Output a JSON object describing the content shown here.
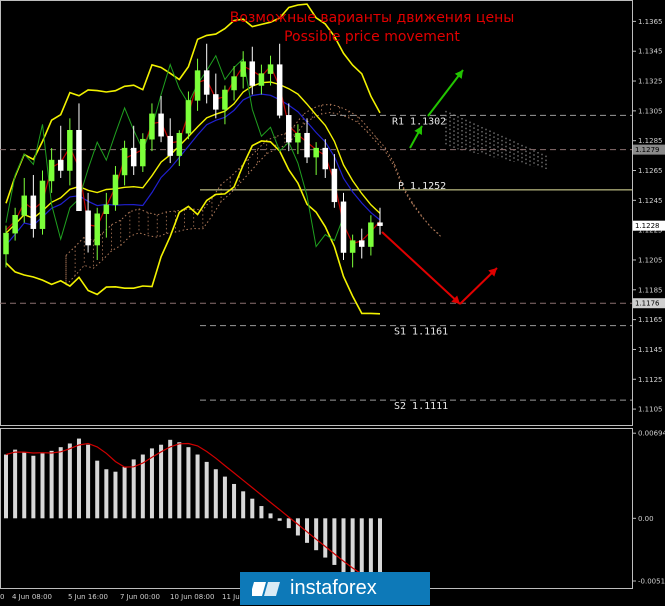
{
  "chart_data": {
    "type": "candlestick",
    "title_ru": "Возможные варианты движения цены",
    "title_en": "Possible price movement",
    "x_tick_labels": [
      "0",
      "4 Jun 08:00",
      "5 Jun 16:00",
      "7 Jun 00:00",
      "10 Jun 08:00",
      "11 Jun"
    ],
    "y_tick_labels": [
      "1.1365",
      "1.1345",
      "1.1325",
      "1.1305",
      "1.1285",
      "1.1265",
      "1.1245",
      "1.1225",
      "1.1205",
      "1.1185",
      "1.1165",
      "1.1145",
      "1.1125",
      "1.1105"
    ],
    "ylim": [
      1.1095,
      1.1378
    ],
    "levels": [
      {
        "label": "R1",
        "value": 1.1302
      },
      {
        "label": "P",
        "value": 1.1252
      },
      {
        "label": "S1",
        "value": 1.1161
      },
      {
        "label": "S2",
        "value": 1.1111
      }
    ],
    "level_labels": [
      "R1  1.1302",
      "P  1.1252",
      "S1  1.1161",
      "S2  1.1111"
    ],
    "price_tags": [
      "1.1279",
      "1.1228",
      "1.1176"
    ],
    "price_tag_values": [
      1.1279,
      1.1228,
      1.1176
    ],
    "price_tag_colors": [
      "#8a8a8a",
      "#ffffff",
      "#d0d0d0"
    ],
    "oscillator": {
      "y_tick_labels": [
        "0.00694",
        "0.00",
        "-0.00511"
      ],
      "ylim": [
        -0.0056,
        0.0072
      ]
    },
    "arrows": [
      {
        "direction": "up",
        "color": "#22c400"
      },
      {
        "direction": "down-then-up",
        "color": "#e00000"
      }
    ],
    "candles": [
      [
        1.1209,
        1.1228,
        1.12,
        1.1223
      ],
      [
        1.1223,
        1.124,
        1.1218,
        1.1235
      ],
      [
        1.1235,
        1.126,
        1.123,
        1.1248
      ],
      [
        1.1248,
        1.1262,
        1.122,
        1.1226
      ],
      [
        1.1226,
        1.1265,
        1.1222,
        1.1258
      ],
      [
        1.1258,
        1.128,
        1.125,
        1.1272
      ],
      [
        1.1272,
        1.1295,
        1.126,
        1.1265
      ],
      [
        1.1265,
        1.13,
        1.1255,
        1.1292
      ],
      [
        1.1292,
        1.131,
        1.124,
        1.1238
      ],
      [
        1.1238,
        1.125,
        1.121,
        1.1215
      ],
      [
        1.1215,
        1.124,
        1.1205,
        1.1236
      ],
      [
        1.1236,
        1.125,
        1.122,
        1.1242
      ],
      [
        1.1242,
        1.1268,
        1.1238,
        1.1262
      ],
      [
        1.1262,
        1.1285,
        1.1255,
        1.128
      ],
      [
        1.128,
        1.1295,
        1.1262,
        1.1268
      ],
      [
        1.1268,
        1.129,
        1.1264,
        1.1286
      ],
      [
        1.1286,
        1.131,
        1.1278,
        1.1303
      ],
      [
        1.1303,
        1.1315,
        1.1284,
        1.1288
      ],
      [
        1.1288,
        1.13,
        1.127,
        1.1275
      ],
      [
        1.1275,
        1.1292,
        1.1268,
        1.129
      ],
      [
        1.129,
        1.1318,
        1.1286,
        1.1312
      ],
      [
        1.1312,
        1.134,
        1.1305,
        1.1332
      ],
      [
        1.1332,
        1.135,
        1.131,
        1.1316
      ],
      [
        1.1316,
        1.133,
        1.13,
        1.1306
      ],
      [
        1.1306,
        1.1322,
        1.1296,
        1.1319
      ],
      [
        1.1319,
        1.1335,
        1.1312,
        1.1328
      ],
      [
        1.1328,
        1.1345,
        1.132,
        1.1338
      ],
      [
        1.1338,
        1.1348,
        1.1316,
        1.1322
      ],
      [
        1.1322,
        1.1336,
        1.1316,
        1.133
      ],
      [
        1.133,
        1.1342,
        1.1322,
        1.1336
      ],
      [
        1.1336,
        1.135,
        1.13,
        1.1302
      ],
      [
        1.1302,
        1.131,
        1.1278,
        1.1284
      ],
      [
        1.1284,
        1.1296,
        1.1276,
        1.129
      ],
      [
        1.129,
        1.13,
        1.127,
        1.1274
      ],
      [
        1.1274,
        1.1284,
        1.1262,
        1.128
      ],
      [
        1.128,
        1.1286,
        1.126,
        1.1266
      ],
      [
        1.1266,
        1.1276,
        1.124,
        1.1244
      ],
      [
        1.1244,
        1.125,
        1.1205,
        1.121
      ],
      [
        1.121,
        1.1222,
        1.12,
        1.1218
      ],
      [
        1.1218,
        1.1226,
        1.1206,
        1.1214
      ],
      [
        1.1214,
        1.1235,
        1.1208,
        1.123
      ],
      [
        1.123,
        1.124,
        1.1222,
        1.1228
      ]
    ],
    "oscillator_values": [
      0.0052,
      0.0056,
      0.0054,
      0.0051,
      0.0053,
      0.0055,
      0.0058,
      0.0061,
      0.0065,
      0.006,
      0.0047,
      0.004,
      0.0038,
      0.0042,
      0.0048,
      0.0052,
      0.0057,
      0.006,
      0.0064,
      0.0062,
      0.0058,
      0.0052,
      0.0046,
      0.004,
      0.0034,
      0.0028,
      0.0022,
      0.0016,
      0.001,
      0.0004,
      -0.0002,
      -0.0008,
      -0.0014,
      -0.002,
      -0.0026,
      -0.0032,
      -0.0038,
      -0.0044,
      -0.0048,
      -0.0052,
      -0.005,
      -0.0047
    ]
  }
}
